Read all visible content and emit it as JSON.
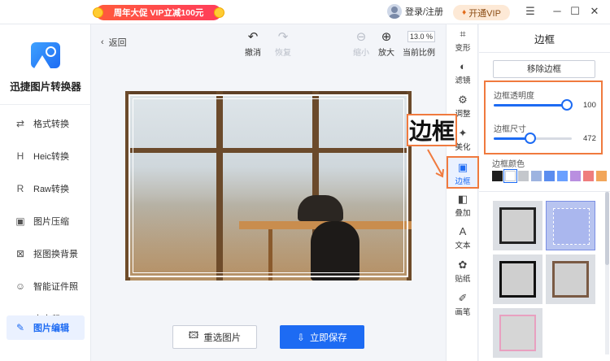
{
  "titlebar": {
    "promo": "周年大促 VIP立减100元",
    "login": "登录/注册",
    "vip": "开通VIP",
    "menu_glyph": "☰",
    "min_glyph": "─",
    "max_glyph": "☐",
    "close_glyph": "✕"
  },
  "sidebar": {
    "app_name": "迅捷图片转换器",
    "items": [
      {
        "label": "格式转换",
        "icon": "⇄"
      },
      {
        "label": "Heic转换",
        "icon": "H"
      },
      {
        "label": "Raw转换",
        "icon": "R"
      },
      {
        "label": "图片压缩",
        "icon": "▣"
      },
      {
        "label": "抠图换背景",
        "icon": "⊠"
      },
      {
        "label": "智能证件照",
        "icon": "☺"
      },
      {
        "label": "去水印",
        "icon": "◎"
      },
      {
        "label": "图片编辑",
        "icon": "✎"
      }
    ]
  },
  "canvas": {
    "back_label": "返回",
    "undo_label": "撤消",
    "redo_label": "恢复",
    "zoom_out_label": "缩小",
    "zoom_in_label": "放大",
    "zoom_value": "13.0 %",
    "ratio_label": "当前比例",
    "reselect_label": "重选图片",
    "save_label": "立即保存"
  },
  "callout": "边框",
  "strip": [
    {
      "label": "变形",
      "icon": "⌗"
    },
    {
      "label": "滤镜",
      "icon": "◐"
    },
    {
      "label": "调整",
      "icon": "⚙"
    },
    {
      "label": "美化",
      "icon": "✦"
    },
    {
      "label": "边框",
      "icon": "▣"
    },
    {
      "label": "叠加",
      "icon": "◧"
    },
    {
      "label": "文本",
      "icon": "A"
    },
    {
      "label": "贴纸",
      "icon": "✿"
    },
    {
      "label": "画笔",
      "icon": "✐"
    }
  ],
  "panel": {
    "title": "边框",
    "remove_label": "移除边框",
    "opacity_label": "边框透明度",
    "opacity_value": "100",
    "opacity_fraction": 0.94,
    "size_label": "边框尺寸",
    "size_value": "472",
    "size_fraction": 0.47,
    "color_label": "边框颜色",
    "swatches": [
      "#1f1f1f",
      "#ffffff",
      "#c4c7cc",
      "#9db3e0",
      "#5b8def",
      "#6aa0ff",
      "#b98fe0",
      "#ef7d7d",
      "#f2a65a"
    ]
  }
}
